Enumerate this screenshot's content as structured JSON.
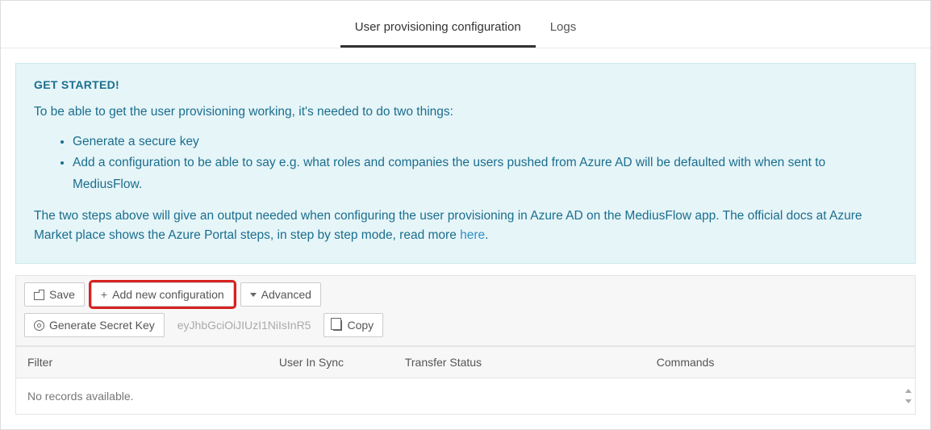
{
  "tabs": {
    "config": "User provisioning configuration",
    "logs": "Logs"
  },
  "info": {
    "title": "GET STARTED!",
    "intro": "To be able to get the user provisioning working, it's needed to do two things:",
    "bullet1": "Generate a secure key",
    "bullet2": "Add a configuration to be able to say e.g. what roles and companies the users pushed from Azure AD will be defaulted with when sent to MediusFlow.",
    "footer_pre": "The two steps above will give an output needed when configuring the user provisioning in Azure AD on the MediusFlow app. The official docs at Azure Market place shows the Azure Portal steps, in step by step mode, read more ",
    "footer_link": "here",
    "footer_post": "."
  },
  "toolbar": {
    "save": "Save",
    "add_config": "Add new configuration",
    "advanced": "Advanced",
    "gen_key": "Generate Secret Key",
    "key_preview": "eyJhbGciOiJIUzI1NiIsInR5",
    "copy": "Copy"
  },
  "table": {
    "headers": {
      "filter": "Filter",
      "user_in_sync": "User In Sync",
      "transfer_status": "Transfer Status",
      "commands": "Commands"
    },
    "empty": "No records available."
  }
}
